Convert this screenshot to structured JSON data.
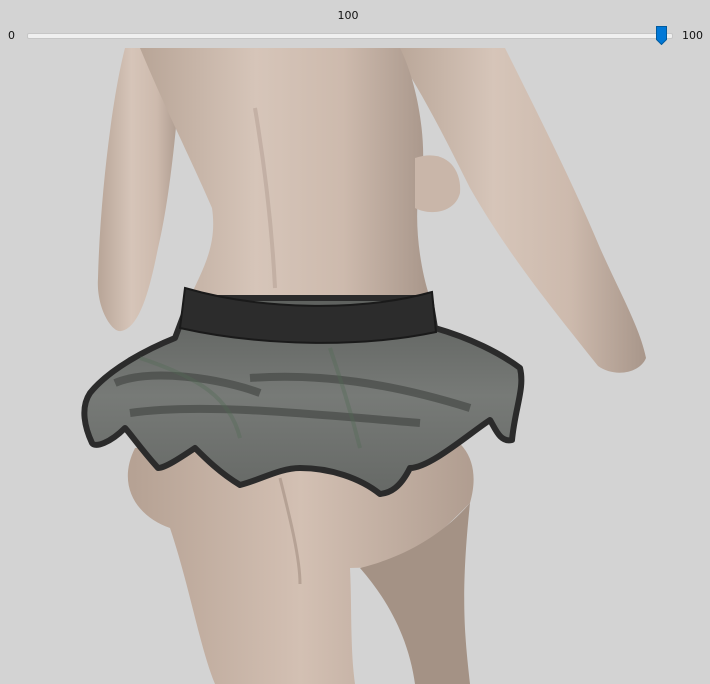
{
  "slider": {
    "current_value": "100",
    "min_label": "0",
    "max_label": "100",
    "min": 0,
    "max": 100,
    "value": 100,
    "accent_color": "#0078d7"
  },
  "viewport": {
    "background_color": "#d3d3d3",
    "skin_color": "#d4c2b6",
    "skirt_color": "#6d706d",
    "waistband_color": "#2c2c2c"
  }
}
